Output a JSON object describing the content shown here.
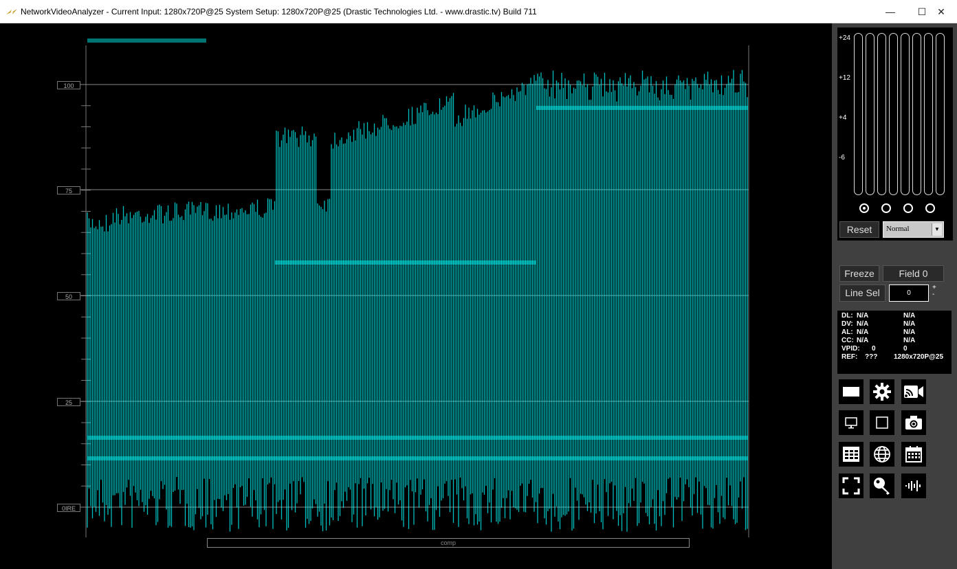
{
  "window": {
    "title": "NetworkVideoAnalyzer - Current Input: 1280x720P@25  System Setup: 1280x720P@25    (Drastic Technologies Ltd. - www.drastic.tv) Build 711",
    "minimize": "—",
    "maximize": "☐",
    "close": "✕"
  },
  "scope": {
    "graticule_labels": [
      "100",
      "75",
      "50",
      "25",
      "0IRE"
    ],
    "bottom_label": "comp",
    "trace_color": "#00ffff"
  },
  "audio": {
    "scale_labels": [
      "+24",
      "+12",
      "+4",
      "-6"
    ],
    "channel_count": 8,
    "selectors": 4,
    "selected_index": 0
  },
  "controls": {
    "reset": "Reset",
    "mode": "Normal",
    "freeze": "Freeze",
    "field": "Field 0",
    "line_sel": "Line Sel",
    "line_value": "0",
    "plus": "+",
    "minus": "-"
  },
  "info": {
    "rows": [
      {
        "label": "DL:",
        "a": "N/A",
        "b": "N/A"
      },
      {
        "label": "DV:",
        "a": "N/A",
        "b": "N/A"
      },
      {
        "label": "AL:",
        "a": "N/A",
        "b": "N/A"
      },
      {
        "label": "CC:",
        "a": "N/A",
        "b": "N/A"
      },
      {
        "label": "VPID:",
        "a": "0",
        "b": "0"
      },
      {
        "label": "REF:",
        "a": "???",
        "b": "1280x720P@25"
      }
    ]
  },
  "icons": [
    "display-mode-icon",
    "settings-gear-icon",
    "stream-camera-icon",
    "monitor-icon",
    "square-icon",
    "snapshot-camera-icon",
    "table-icon",
    "globe-icon",
    "calendar-icon",
    "fullscreen-icon",
    "search-key-icon",
    "audio-waveform-icon"
  ]
}
